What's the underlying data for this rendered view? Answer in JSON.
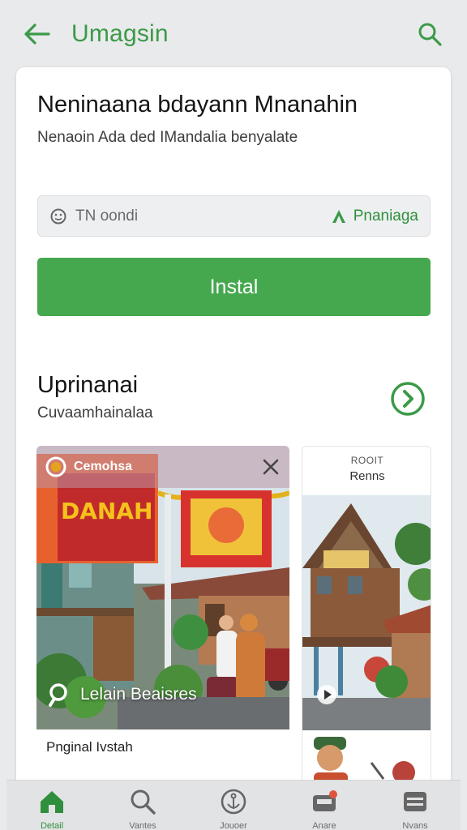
{
  "appbar": {
    "title": "Umagsin",
    "back_icon": "arrow-left-icon",
    "search_icon": "search-icon"
  },
  "app": {
    "name": "Neninaana bdayann Mnanahin",
    "subtitle": "Nenaoin Ada ded IMandalia benyalate"
  },
  "field": {
    "value": "TN oondi",
    "right_label": "Pnaniaga",
    "icon": "smiley-icon",
    "right_icon": "triangle-a-icon"
  },
  "install": {
    "label": "Instal"
  },
  "section": {
    "title": "Uprinanai",
    "subtitle": "Cuvaamhainalaa",
    "arrow_icon": "chevron-right-circle-icon"
  },
  "tiles": [
    {
      "overlay_label": "Cemohsa",
      "caption": "Lelain Beaisres",
      "footer": "Pnginal Ivstah",
      "banner_text": "DANAH"
    },
    {
      "kicker": "ROOIT",
      "title": "Renns"
    }
  ],
  "nav": [
    {
      "label": "Detail",
      "icon": "home-icon",
      "active": true
    },
    {
      "label": "Vantes",
      "icon": "search-icon",
      "active": false
    },
    {
      "label": "Jouoer",
      "icon": "anchor-icon",
      "active": false
    },
    {
      "label": "Anare",
      "icon": "inbox-icon",
      "active": false
    },
    {
      "label": "Nvans",
      "icon": "menu-icon",
      "active": false
    }
  ],
  "colors": {
    "accent": "#45a84f",
    "accent_text": "#3b9a48",
    "background": "#e9eaec",
    "card": "#ffffff"
  }
}
